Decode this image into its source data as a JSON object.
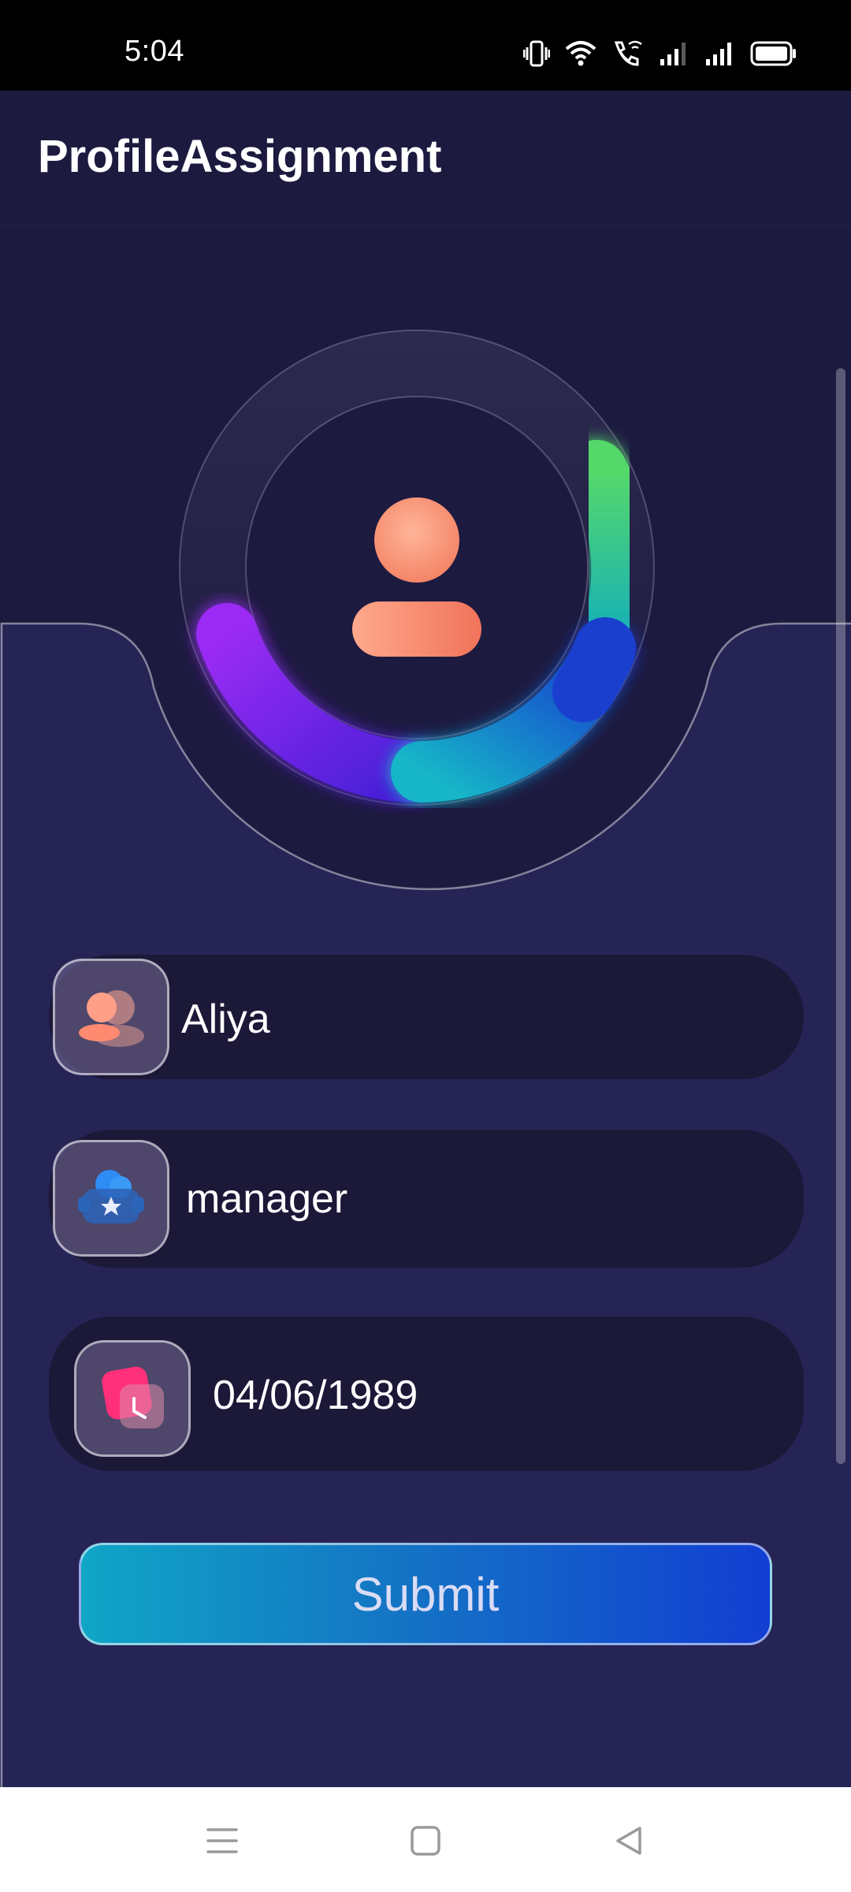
{
  "status_bar": {
    "time": "5:04",
    "icons": [
      "vibrate-icon",
      "wifi-icon",
      "wifi-call-icon",
      "signal-icon",
      "signal-icon",
      "battery-icon"
    ]
  },
  "app_bar": {
    "title": "ProfileAssignment"
  },
  "avatar": {
    "icon": "user-icon",
    "ring_colors": [
      "#9b2cf5",
      "#4a1fd8",
      "#12b6c8",
      "#1a39cf",
      "#55d86a"
    ]
  },
  "form": {
    "name": {
      "icon": "person-icon",
      "value": "Aliya"
    },
    "role": {
      "icon": "badge-star-icon",
      "value": "manager"
    },
    "dob": {
      "icon": "calendar-clock-icon",
      "value": "04/06/1989"
    }
  },
  "submit": {
    "label": "Submit",
    "gradient": [
      "#10a6c6",
      "#123ed2"
    ]
  },
  "nav_bar": {
    "icons": [
      "menu-icon",
      "home-icon",
      "back-icon"
    ]
  }
}
